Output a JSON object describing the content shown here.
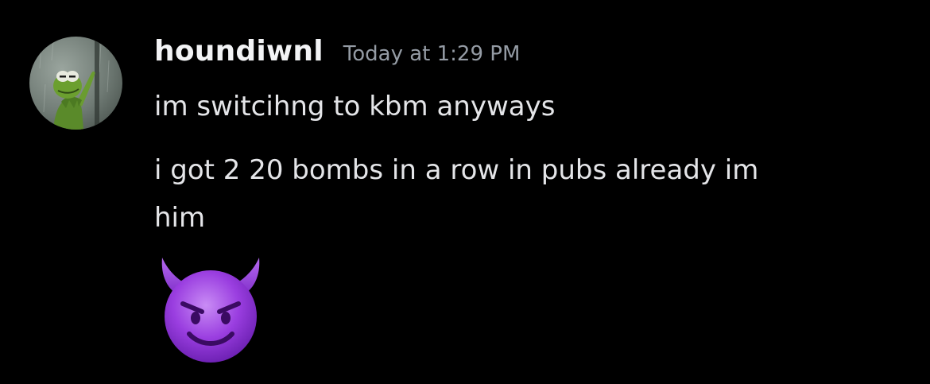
{
  "message": {
    "author": {
      "username": "houndiwnl",
      "avatar_icon": "kermit-window-avatar"
    },
    "timestamp": "Today at 1:29 PM",
    "lines": [
      "im switcihng to kbm anyways",
      "i got 2 20 bombs in a row in pubs already im",
      "him"
    ],
    "emoji": "smiling-face-with-horns-emoji"
  },
  "colors": {
    "background": "#000000",
    "username": "#f2f3f5",
    "timestamp": "#949ba4",
    "text": "#e4e5e8",
    "emoji_purple": "#9a3ee0"
  }
}
